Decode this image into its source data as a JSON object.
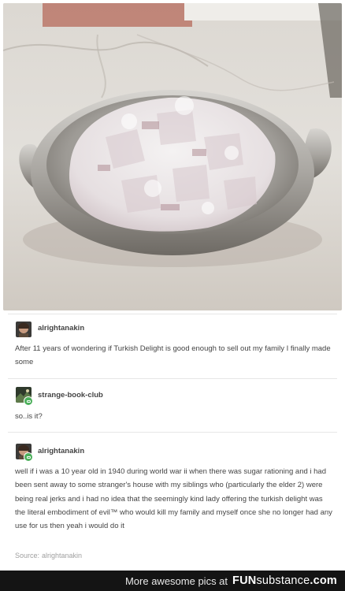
{
  "photo": {
    "description_icon": "bowl-of-turkish-delight-image"
  },
  "posts": [
    {
      "username": "alrightanakin",
      "text": "After 11 years of wondering if Turkish Delight is good enough to sell out my family I finally made some"
    },
    {
      "username": "strange-book-club",
      "text": "so..is it?"
    },
    {
      "username": "alrightanakin",
      "text": "well if i was a 10 year old in 1940 during world war ii when there was sugar rationing and i had been sent away to some stranger's house with my siblings who (particularly the elder 2) were being real jerks and i had no idea that the seemingly kind lady offering the turkish delight was the literal embodiment of evil™ who would kill my family and myself once she no longer had any use for us then yeah i would do it"
    }
  ],
  "source": {
    "label": "Source:",
    "user": "alrightanakin"
  },
  "footer": {
    "more_text": "More awesome pics at",
    "logo_part1": "FUN",
    "logo_part2": "substance",
    "logo_part3": ".com"
  },
  "colors": {
    "footer_bg": "#141414",
    "badge_green": "#4cb05b"
  }
}
